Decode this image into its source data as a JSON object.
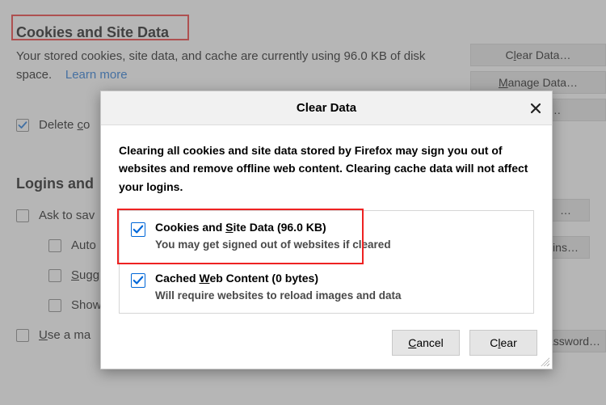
{
  "cookies": {
    "heading": "Cookies and Site Data",
    "desc_1": "Your stored cookies, site data, and cache are currently using 96.0 KB of disk space.",
    "learn_more": "Learn more",
    "delete_label_pre": "Delete ",
    "delete_label_ul": "c",
    "delete_label_post": "o",
    "btn_clear_pre": "C",
    "btn_clear_ul": "l",
    "btn_clear_post": "ear Data…",
    "btn_manage_pre": "",
    "btn_manage_ul": "M",
    "btn_manage_post": "anage Data…",
    "btn_perm_post": "issions…"
  },
  "logins": {
    "heading": "Logins and",
    "ask": "Ask to sav",
    "auto": "Auto",
    "sugg_ul": "S",
    "sugg_post": "ugg",
    "show": "Show",
    "master_pre": "",
    "master_ul": "U",
    "master_post": "se a ma",
    "btn_ins": "ins…",
    "btn_pwd": "assword…"
  },
  "dialog": {
    "title": "Clear Data",
    "message": "Clearing all cookies and site data stored by Firefox may sign you out of websites and remove offline web content. Clearing cache data will not affect your logins.",
    "opt1_title_pre": "Cookies and ",
    "opt1_title_ul": "S",
    "opt1_title_post": "ite Data (96.0 KB)",
    "opt1_sub": "You may get signed out of websites if cleared",
    "opt2_title_pre": "Cached ",
    "opt2_title_ul": "W",
    "opt2_title_post": "eb Content (0 bytes)",
    "opt2_sub": "Will require websites to reload images and data",
    "cancel_ul": "C",
    "cancel_post": "ancel",
    "clear_pre": "C",
    "clear_ul": "l",
    "clear_post": "ear"
  }
}
